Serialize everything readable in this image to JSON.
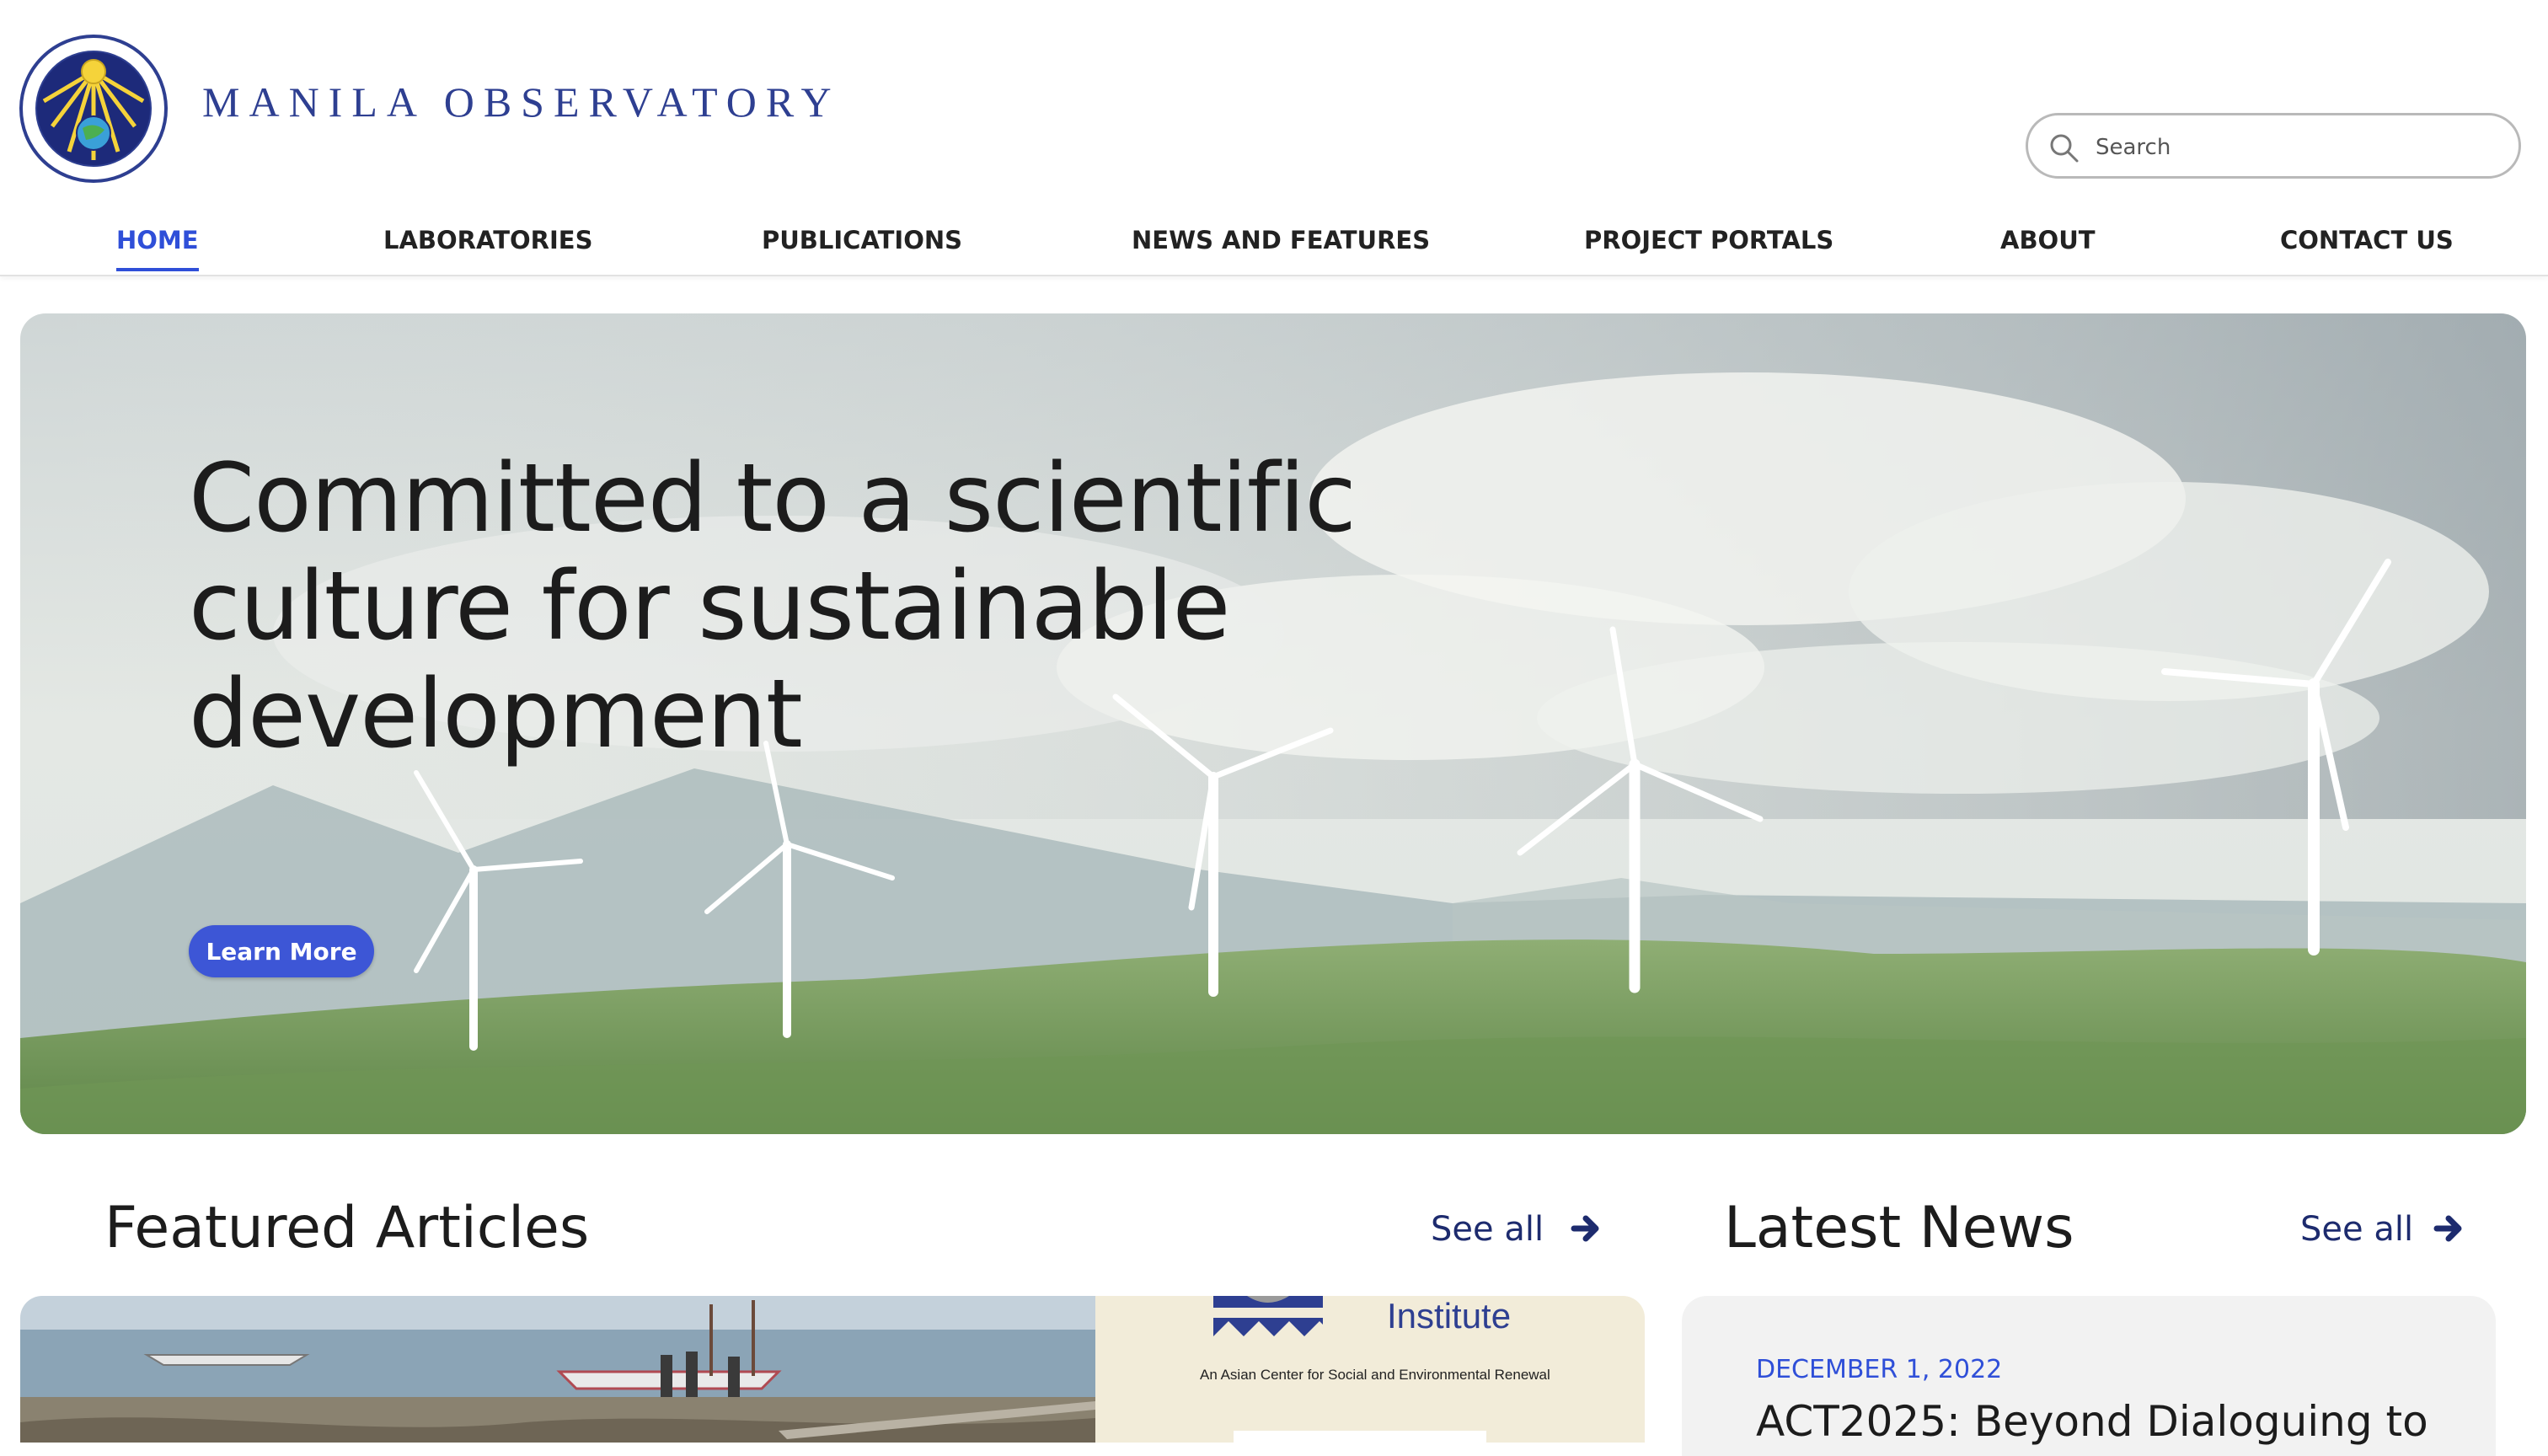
{
  "header": {
    "brand": "MANILA OBSERVATORY",
    "search_placeholder": "Search"
  },
  "nav": {
    "items": [
      {
        "label": "HOME",
        "active": true
      },
      {
        "label": "LABORATORIES"
      },
      {
        "label": "PUBLICATIONS"
      },
      {
        "label": "NEWS AND FEATURES"
      },
      {
        "label": "PROJECT PORTALS"
      },
      {
        "label": "ABOUT"
      },
      {
        "label": "CONTACT US"
      }
    ]
  },
  "hero": {
    "headline": "Committed to a scientific culture for sustainable development",
    "button_label": "Learn More"
  },
  "featured": {
    "title": "Featured Articles",
    "see_all": "See all",
    "card": {
      "partner_name": "Institute",
      "partner_tagline": "An Asian Center for Social and Environmental Renewal"
    }
  },
  "news": {
    "title": "Latest News",
    "see_all": "See all",
    "item": {
      "date": "DECEMBER 1, 2022",
      "title": "ACT2025: Beyond Dialoguing to"
    }
  },
  "colors": {
    "accent": "#2f4fd8",
    "brand": "#2e3f91",
    "see_all": "#1d2b6e"
  }
}
